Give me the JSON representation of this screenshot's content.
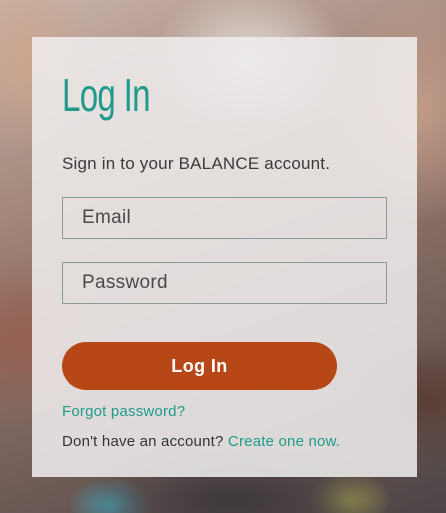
{
  "login": {
    "title": "Log In",
    "subtitle": "Sign in to your BALANCE account.",
    "email_placeholder": "Email",
    "password_placeholder": "Password",
    "button_label": "Log In",
    "forgot_password": "Forgot password?",
    "no_account_text": "Don't have an account?",
    "create_account": "Create one now."
  },
  "colors": {
    "accent": "#1f9a8b",
    "button": "#b84717",
    "card": "#eeecec"
  }
}
